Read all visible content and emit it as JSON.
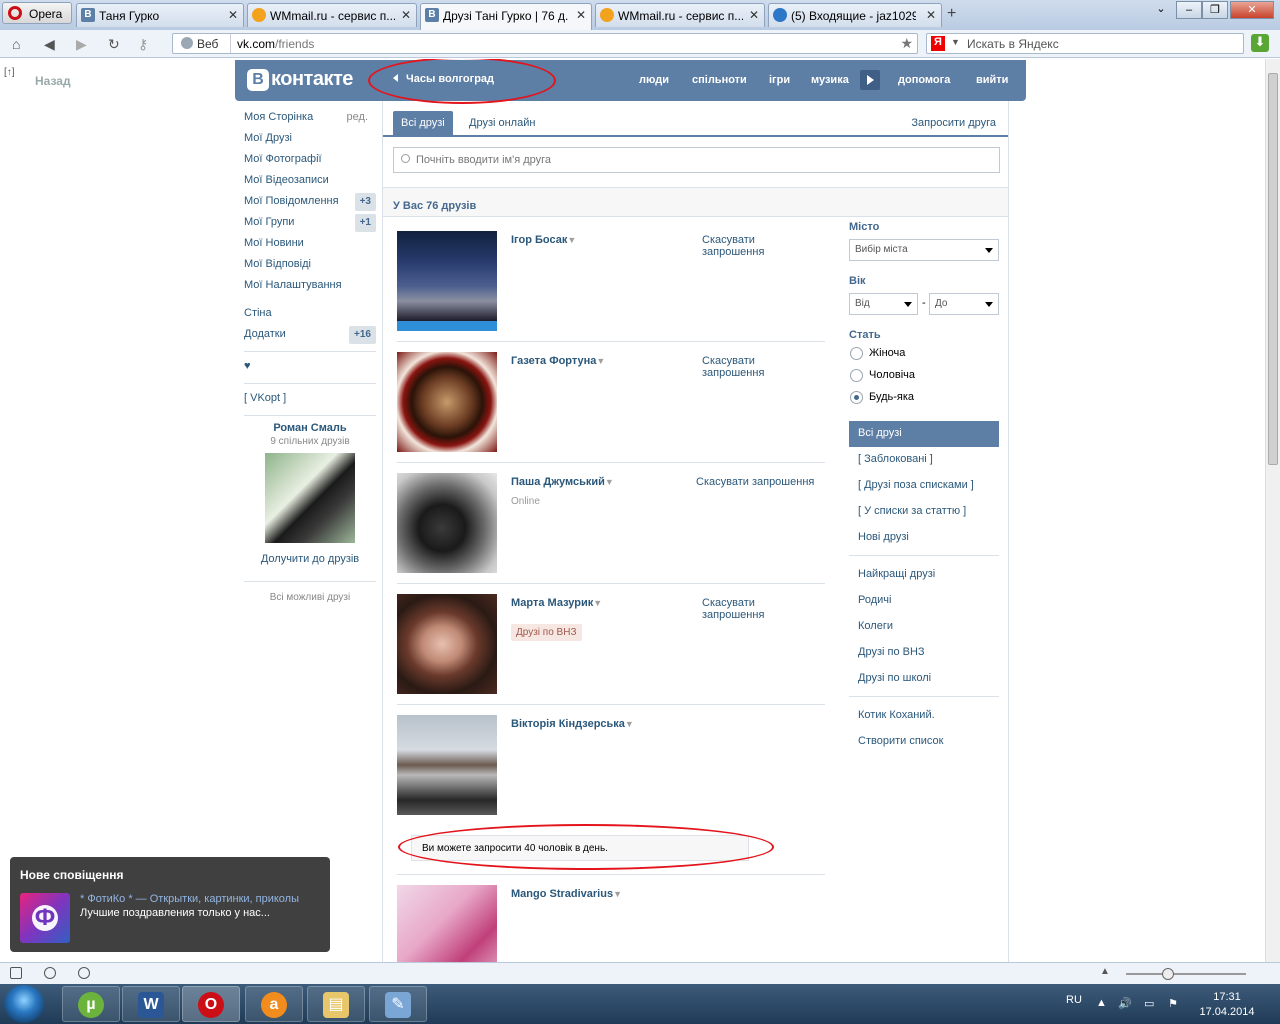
{
  "browser": {
    "opera_label": "Opera",
    "tabs": [
      {
        "title": "Таня Гурко",
        "icon": "vk-icon"
      },
      {
        "title": "WMmail.ru - сервис п...",
        "icon": "wmmail-icon"
      },
      {
        "title": "Друзі Тані Гурко | 76 д...",
        "icon": "vk-icon"
      },
      {
        "title": "WMmail.ru - сервис п...",
        "icon": "wmmail-icon"
      },
      {
        "title": "(5) Входящие - jaz1029...",
        "icon": "mail-icon"
      }
    ],
    "web_label": "Веб",
    "url_host": "vk.com",
    "url_path": "/friends",
    "search_placeholder": "Искать в Яндекс"
  },
  "page": {
    "back_label": "Назад",
    "back_icon": "[↑]",
    "header": {
      "logo_letter": "В",
      "logo_text": "контакте",
      "player_title": "Часы волгоград",
      "nav": [
        "люди",
        "спільноти",
        "ігри",
        "музика",
        "допомога",
        "вийти"
      ]
    },
    "left_menu": {
      "items": [
        {
          "label": "Моя Сторінка",
          "extra": "ред."
        },
        {
          "label": "Мої Друзі"
        },
        {
          "label": "Мої Фотографії"
        },
        {
          "label": "Мої Відеозаписи"
        },
        {
          "label": "Мої Повідомлення",
          "count": "+3"
        },
        {
          "label": "Мої Групи",
          "count": "+1"
        },
        {
          "label": "Мої Новини"
        },
        {
          "label": "Мої Відповіді"
        },
        {
          "label": "Мої Налаштування"
        }
      ],
      "items2": [
        {
          "label": "Стіна"
        },
        {
          "label": "Додатки",
          "count": "+16"
        }
      ],
      "heart": "♥",
      "vkopt": "[ VKopt ]",
      "recommend": {
        "name": "Роман Смаль",
        "mutual": "9 спільних друзів",
        "add": "Долучити до друзів",
        "all": "Всі можливі друзі"
      }
    },
    "content": {
      "tab_all": "Всі друзі",
      "tab_online": "Друзі онлайн",
      "invite": "Запросити друга",
      "search_placeholder": "Почніть вводити ім'я друга",
      "summary": "У Вас 76 друзів",
      "friends": [
        {
          "name": "Ігор Босак",
          "action": "Скасувати запрошення"
        },
        {
          "name": "Газета Фортуна",
          "action": "Скасувати запрошення"
        },
        {
          "name": "Паша Джумський",
          "status": "Online",
          "action": "Скасувати запрошення"
        },
        {
          "name": "Марта Мазурик",
          "tag": "Друзі по ВНЗ",
          "action": "Скасувати запрошення"
        },
        {
          "name": "Вікторія Кіндзерська"
        },
        {
          "name": "Mango Stradivarius"
        }
      ],
      "limit_notice": "Ви можете запросити 40 чоловік в день.",
      "dropdown_glyph": "▼"
    },
    "filter": {
      "city_label": "Місто",
      "city_select": "Вибір міста",
      "age_label": "Вік",
      "age_from": "Від",
      "age_dash": "-",
      "age_to": "До",
      "gender_label": "Стать",
      "genders": [
        "Жіноча",
        "Чоловіча",
        "Будь-яка"
      ],
      "gender_selected": "Будь-яка",
      "lists1": [
        "Всі друзі",
        "[ Заблоковані ]",
        "[ Друзі поза списками ]",
        "[ У списки за статтю ]",
        "Нові друзі"
      ],
      "lists2": [
        "Найкращі друзі",
        "Родичі",
        "Колеги",
        "Друзі по ВНЗ",
        "Друзі по школі"
      ],
      "lists3": [
        "Котик Коханий.",
        "Створити список"
      ]
    },
    "notification": {
      "title": "Нове сповіщення",
      "icon_letter": "Ф",
      "source": "* ФотиКо * — Открытки, картинки, приколы",
      "text": "Лучшие поздравления только у нас..."
    }
  },
  "taskbar": {
    "lang": "RU",
    "time": "17:31",
    "date": "17.04.2014",
    "apps": [
      "utorrent-icon",
      "word-icon",
      "opera-icon",
      "avast-icon",
      "explorer-icon",
      "paint-icon"
    ]
  },
  "colors": {
    "vk_blue": "#5d7ea5",
    "link": "#2b587a",
    "annotation_red": "#e3141b"
  }
}
